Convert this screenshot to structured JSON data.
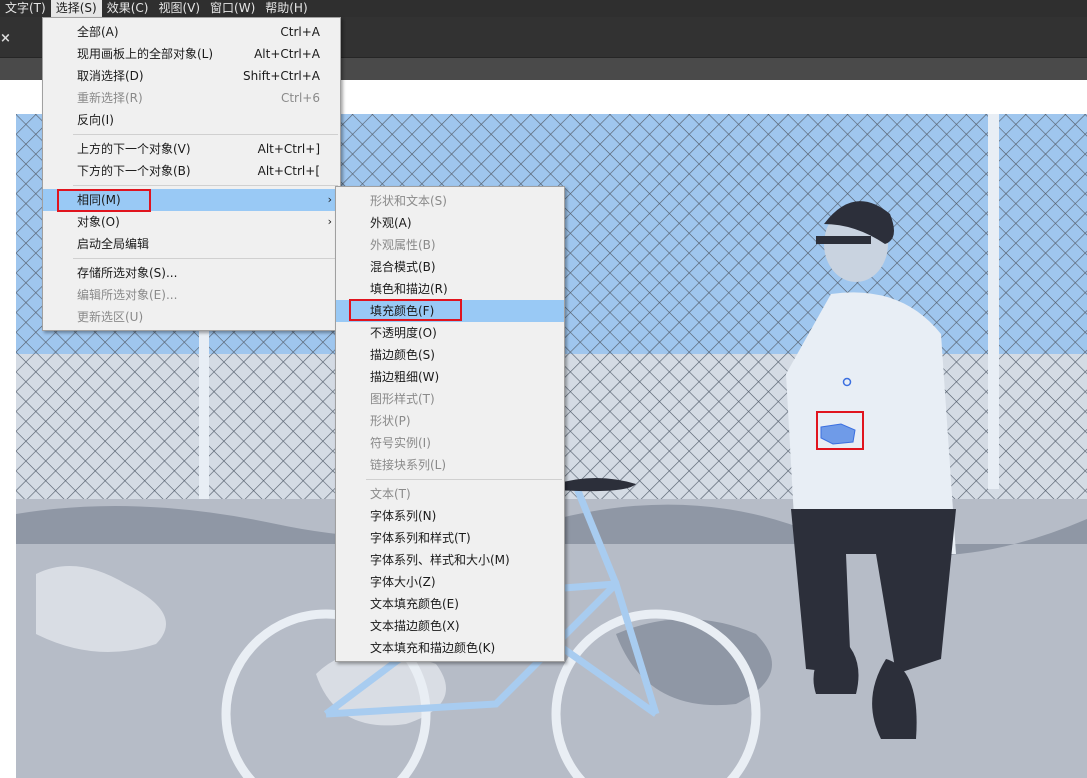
{
  "menubar": {
    "items": [
      {
        "label": "文字(T)"
      },
      {
        "label": "选择(S)"
      },
      {
        "label": "效果(C)"
      },
      {
        "label": "视图(V)"
      },
      {
        "label": "窗口(W)"
      },
      {
        "label": "帮助(H)"
      }
    ]
  },
  "tab": {
    "close_icon": "×"
  },
  "select_menu": {
    "all": {
      "label": "全部(A)",
      "shortcut": "Ctrl+A"
    },
    "all_artboard": {
      "label": "现用画板上的全部对象(L)",
      "shortcut": "Alt+Ctrl+A"
    },
    "deselect": {
      "label": "取消选择(D)",
      "shortcut": "Shift+Ctrl+A"
    },
    "reselect": {
      "label": "重新选择(R)",
      "shortcut": "Ctrl+6"
    },
    "inverse": {
      "label": "反向(I)"
    },
    "next_above": {
      "label": "上方的下一个对象(V)",
      "shortcut": "Alt+Ctrl+]"
    },
    "next_below": {
      "label": "下方的下一个对象(B)",
      "shortcut": "Alt+Ctrl+["
    },
    "same": {
      "label": "相同(M)",
      "arrow": "›"
    },
    "object": {
      "label": "对象(O)",
      "arrow": "›"
    },
    "global_edit": {
      "label": "启动全局编辑"
    },
    "save_selection": {
      "label": "存储所选对象(S)..."
    },
    "edit_selection": {
      "label": "编辑所选对象(E)..."
    },
    "update_selection": {
      "label": "更新选区(U)"
    }
  },
  "same_submenu": {
    "items": [
      {
        "label": "形状和文本(S)",
        "disabled": true
      },
      {
        "label": "外观(A)",
        "disabled": false
      },
      {
        "label": "外观属性(B)",
        "disabled": true
      },
      {
        "label": "混合模式(B)",
        "disabled": false
      },
      {
        "label": "填色和描边(R)",
        "disabled": false
      },
      {
        "label": "填充颜色(F)",
        "disabled": false,
        "highlighted": true
      },
      {
        "label": "不透明度(O)",
        "disabled": false
      },
      {
        "label": "描边颜色(S)",
        "disabled": false
      },
      {
        "label": "描边粗细(W)",
        "disabled": false
      },
      {
        "label": "图形样式(T)",
        "disabled": true
      },
      {
        "label": "形状(P)",
        "disabled": true
      },
      {
        "label": "符号实例(I)",
        "disabled": true
      },
      {
        "label": "链接块系列(L)",
        "disabled": true
      },
      {
        "label": "文本(T)",
        "disabled": true
      },
      {
        "label": "字体系列(N)",
        "disabled": false
      },
      {
        "label": "字体系列和样式(T)",
        "disabled": false
      },
      {
        "label": "字体系列、样式和大小(M)",
        "disabled": false
      },
      {
        "label": "字体大小(Z)",
        "disabled": false
      },
      {
        "label": "文本填充颜色(E)",
        "disabled": false
      },
      {
        "label": "文本描边颜色(X)",
        "disabled": false
      },
      {
        "label": "文本填充和描边颜色(K)",
        "disabled": false
      }
    ]
  },
  "colors": {
    "sky": "#9fc6ee",
    "menu_bg": "#f0f0f0",
    "highlight": "#99c9f5",
    "annotation": "#e0141e",
    "selection": "#3b6fe0"
  }
}
